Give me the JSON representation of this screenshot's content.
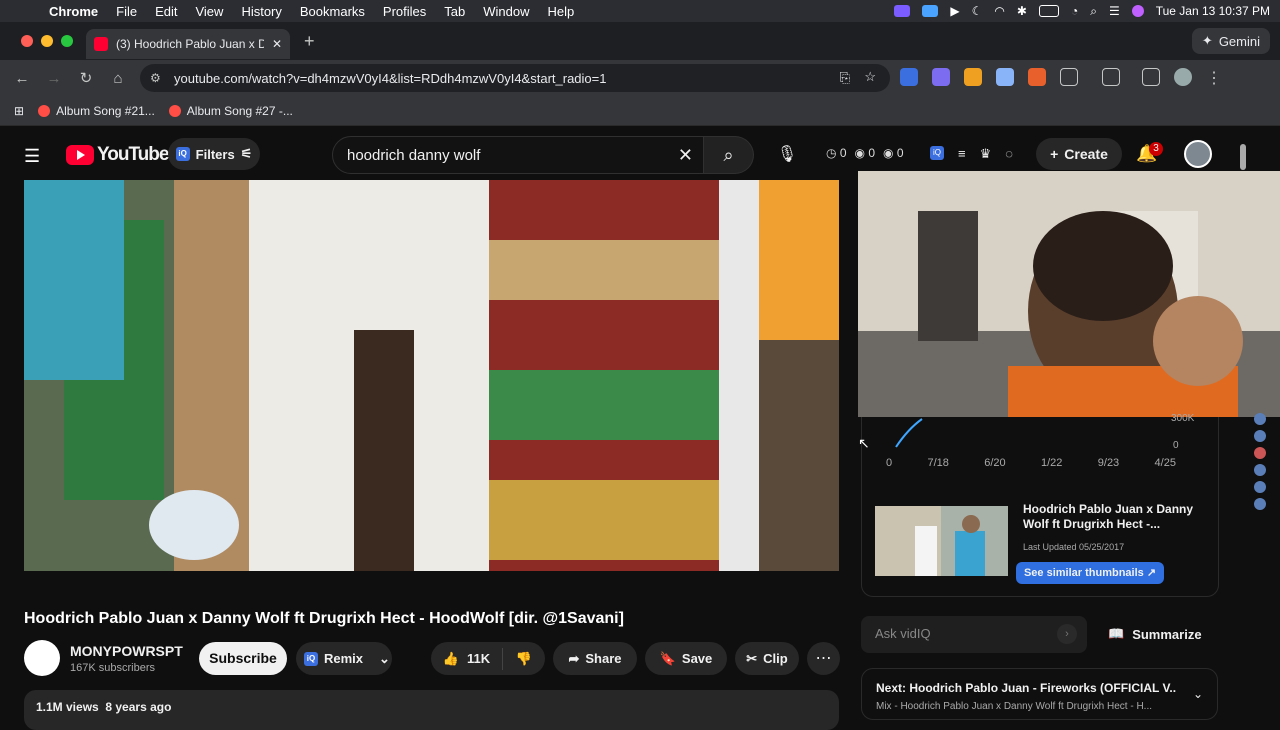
{
  "menubar": {
    "app": "Chrome",
    "items": [
      "File",
      "Edit",
      "View",
      "History",
      "Bookmarks",
      "Profiles",
      "Tab",
      "Window",
      "Help"
    ],
    "clock": "Tue Jan 13  10:37 PM"
  },
  "tab": {
    "title": "(3) Hoodrich Pablo Juan x Da",
    "new_tab": "+"
  },
  "gemini": "Gemini",
  "address": "youtube.com/watch?v=dh4mzwV0yI4&list=RDdh4mzwV0yI4&start_radio=1",
  "bookmarks": [
    "Album Song #21...",
    "Album Song #27 -..."
  ],
  "yt": {
    "logo": "YouTube",
    "filters": "Filters",
    "search_value": "hoodrich danny wolf",
    "stats": [
      "0",
      "0",
      "0"
    ],
    "create": "Create",
    "notif_count": "3"
  },
  "video": {
    "title": "Hoodrich Pablo Juan x Danny Wolf ft Drugrixh Hect - HoodWolf [dir. @1Savani]",
    "channel": "MONYPOWRSPT",
    "subs": "167K subscribers",
    "subscribe": "Subscribe",
    "remix": "Remix",
    "likes": "11K",
    "share": "Share",
    "save": "Save",
    "clip": "Clip",
    "views": "1.1M views",
    "age": "8 years ago"
  },
  "chart": {
    "x_ticks": [
      "0",
      "7/18",
      "6/20",
      "1/22",
      "9/23",
      "4/25"
    ],
    "y_top": "300K",
    "y_zero": "0"
  },
  "similar": {
    "title": "Hoodrich Pablo Juan x Danny Wolf ft Drugrixh Hect -...",
    "date": "Last Updated 05/25/2017",
    "button": "See similar thumbnails ↗"
  },
  "vidiq": {
    "ask_placeholder": "Ask vidIQ",
    "summarize": "Summarize"
  },
  "next": {
    "label": "Next:",
    "title": "Hoodrich Pablo Juan - Fireworks (OFFICIAL V...",
    "sub": "Mix - Hoodrich Pablo Juan x Danny Wolf ft Drugrixh Hect - H..."
  }
}
